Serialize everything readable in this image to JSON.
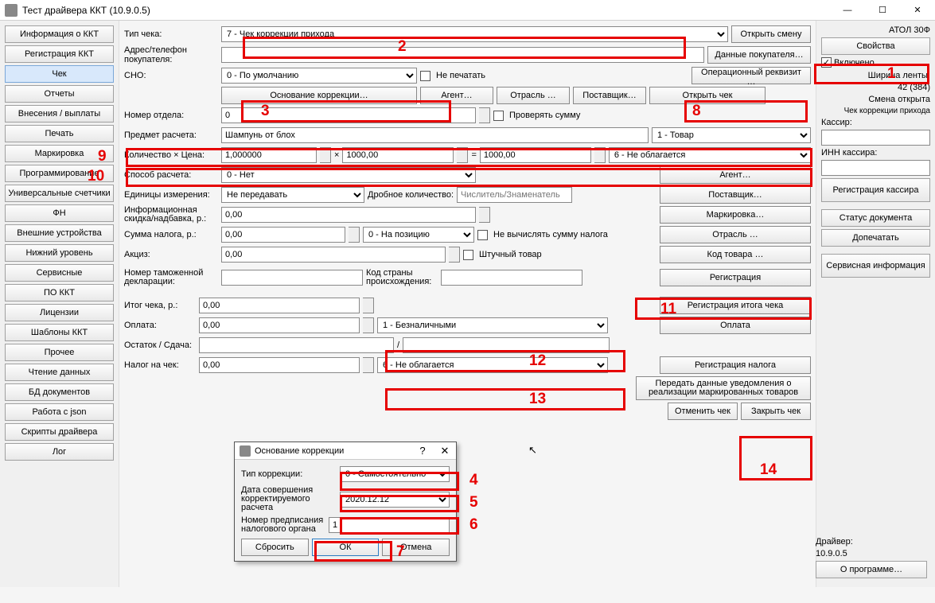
{
  "window": {
    "title": "Тест драйвера ККТ (10.9.0.5)"
  },
  "nav": {
    "info": "Информация о ККТ",
    "reg": "Регистрация ККТ",
    "check": "Чек",
    "reports": "Отчеты",
    "inout": "Внесения / выплаты",
    "print": "Печать",
    "mark": "Маркировка",
    "prog": "Программирование",
    "counters": "Универсальные счетчики",
    "fn": "ФН",
    "ext": "Внешние устройства",
    "low": "Нижний уровень",
    "svc": "Сервисные",
    "pokkt": "ПО ККТ",
    "lic": "Лицензии",
    "tpl": "Шаблоны ККТ",
    "other": "Прочее",
    "read": "Чтение данных",
    "db": "БД документов",
    "json": "Работа с json",
    "scripts": "Скрипты драйвера",
    "log": "Лог"
  },
  "form": {
    "check_type_lbl": "Тип чека:",
    "check_type": "7 - Чек коррекции прихода",
    "addr_lbl": "Адрес/телефон покупателя:",
    "addr": "",
    "sno_lbl": "СНО:",
    "sno": "0 - По умолчанию",
    "noprint": "Не печатать",
    "corr_basis": "Основание коррекции…",
    "agent": "Агент…",
    "industry": "Отрасль …",
    "supplier": "Поставщик…",
    "open_check": "Открыть чек",
    "open_shift": "Открыть смену",
    "buyer_data": "Данные покупателя…",
    "op_req": "Операционный реквизит …",
    "dept_lbl": "Номер отдела:",
    "dept": "0",
    "verify_sum": "Проверять сумму",
    "subject_lbl": "Предмет расчета:",
    "subject": "Шампунь от блох",
    "subject_type": "1 - Товар",
    "qtyprice_lbl": "Количество × Цена:",
    "qty": "1,000000",
    "price": "1000,00",
    "eq": "=",
    "sum": "1000,00",
    "tax_type_qty": "6 - Не облагается",
    "method_lbl": "Способ расчета:",
    "method": "0 - Нет",
    "agent_btn": "Агент…",
    "unit_lbl": "Единицы измерения:",
    "unit": "Не передавать",
    "fraction_lbl": "Дробное количество:",
    "fraction_ph": "Числитель/Знаменатель",
    "supplier_btn": "Поставщик…",
    "discount_lbl": "Информационная скидка/надбавка, р.:",
    "discount": "0,00",
    "mark_btn": "Маркировка…",
    "taxsum_lbl": "Сумма налога, р.:",
    "taxsum": "0,00",
    "taxpos": "0 - На позицию",
    "no_calc_tax": "Не вычислять сумму налога",
    "industry_btn": "Отрасль …",
    "excise_lbl": "Акциз:",
    "excise": "0,00",
    "piece": "Штучный товар",
    "goods_code_btn": "Код товара …",
    "customs_lbl": "Номер таможенной декларации:",
    "country_lbl": "Код страны происхождения:",
    "register_btn": "Регистрация",
    "total_lbl": "Итог чека, р.:",
    "total": "0,00",
    "reg_total_btn": "Регистрация итога чека",
    "pay_lbl": "Оплата:",
    "pay": "0,00",
    "pay_type": "1 - Безналичными",
    "pay_btn": "Оплата",
    "change_lbl": "Остаток / Сдача:",
    "change_sep": "/",
    "checktax_lbl": "Налог на чек:",
    "checktax": "0,00",
    "checktax_type": "6 - Не облагается",
    "reg_tax_btn": "Регистрация налога",
    "send_mark_btn": "Передать данные уведомления о реализации маркированных товаров",
    "cancel_check": "Отменить чек",
    "close_check": "Закрыть чек"
  },
  "right": {
    "device": "АТОЛ 30Ф",
    "props": "Свойства",
    "enabled": "Включено",
    "ribbon_lbl": "Ширина ленты:",
    "ribbon": "42 (384)",
    "shift": "Смена открыта",
    "corrtype": "Чек коррекции прихода",
    "cashier_lbl": "Кассир:",
    "cashier_inn_lbl": "ИНН кассира:",
    "reg_cashier": "Регистрация кассира",
    "doc_status": "Статус документа",
    "finish_print": "Допечатать",
    "svc_info": "Сервисная информация",
    "driver_lbl": "Драйвер:",
    "driver_ver": "10.9.0.5",
    "about": "О программе…"
  },
  "dialog": {
    "title": "Основание коррекции",
    "type_lbl": "Тип коррекции:",
    "type": "0 - Самостоятельно",
    "date_lbl": "Дата совершения корректируемого расчета",
    "date": "2020.12.12",
    "order_lbl": "Номер предписания налогового органа",
    "order": "1",
    "reset": "Сбросить",
    "ok": "ОК",
    "cancel": "Отмена"
  }
}
